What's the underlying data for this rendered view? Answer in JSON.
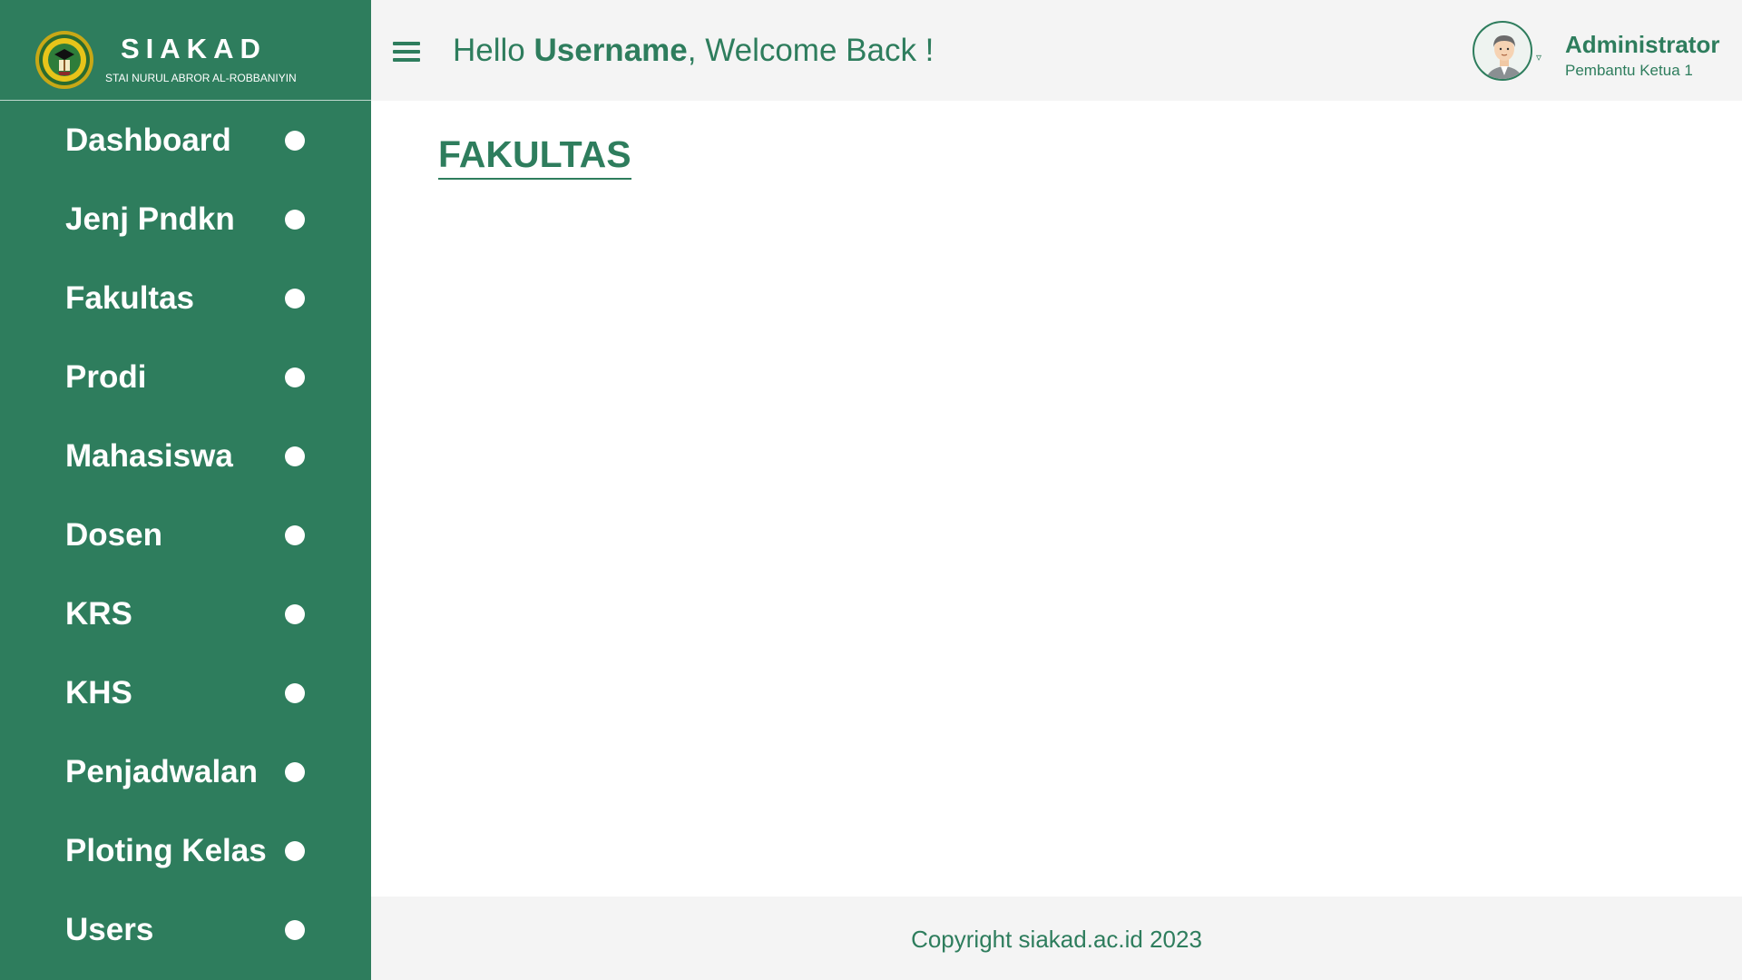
{
  "brand": {
    "title": "SIAKAD",
    "subtitle": "STAI NURUL ABROR AL-ROBBANIYIN",
    "logo_icon": "university-seal-icon"
  },
  "sidebar": {
    "items": [
      {
        "label": "Dashboard"
      },
      {
        "label": "Jenj Pndkn"
      },
      {
        "label": "Fakultas"
      },
      {
        "label": "Prodi"
      },
      {
        "label": "Mahasiswa"
      },
      {
        "label": "Dosen"
      },
      {
        "label": "KRS"
      },
      {
        "label": "KHS"
      },
      {
        "label": "Penjadwalan"
      },
      {
        "label": "Ploting Kelas"
      },
      {
        "label": "Users"
      }
    ]
  },
  "header": {
    "greeting_prefix": "Hello ",
    "greeting_user": "Username",
    "greeting_suffix": ", Welcome Back !",
    "user_name": "Administrator",
    "user_role": "Pembantu Ketua 1",
    "caret": "▿"
  },
  "main": {
    "title": "FAKULTAS"
  },
  "footer": {
    "copyright": "Copyright siakad.ac.id 2023"
  },
  "colors": {
    "primary": "#2e7d5d",
    "header_bg": "#f4f4f4",
    "content_bg": "#ffffff"
  }
}
